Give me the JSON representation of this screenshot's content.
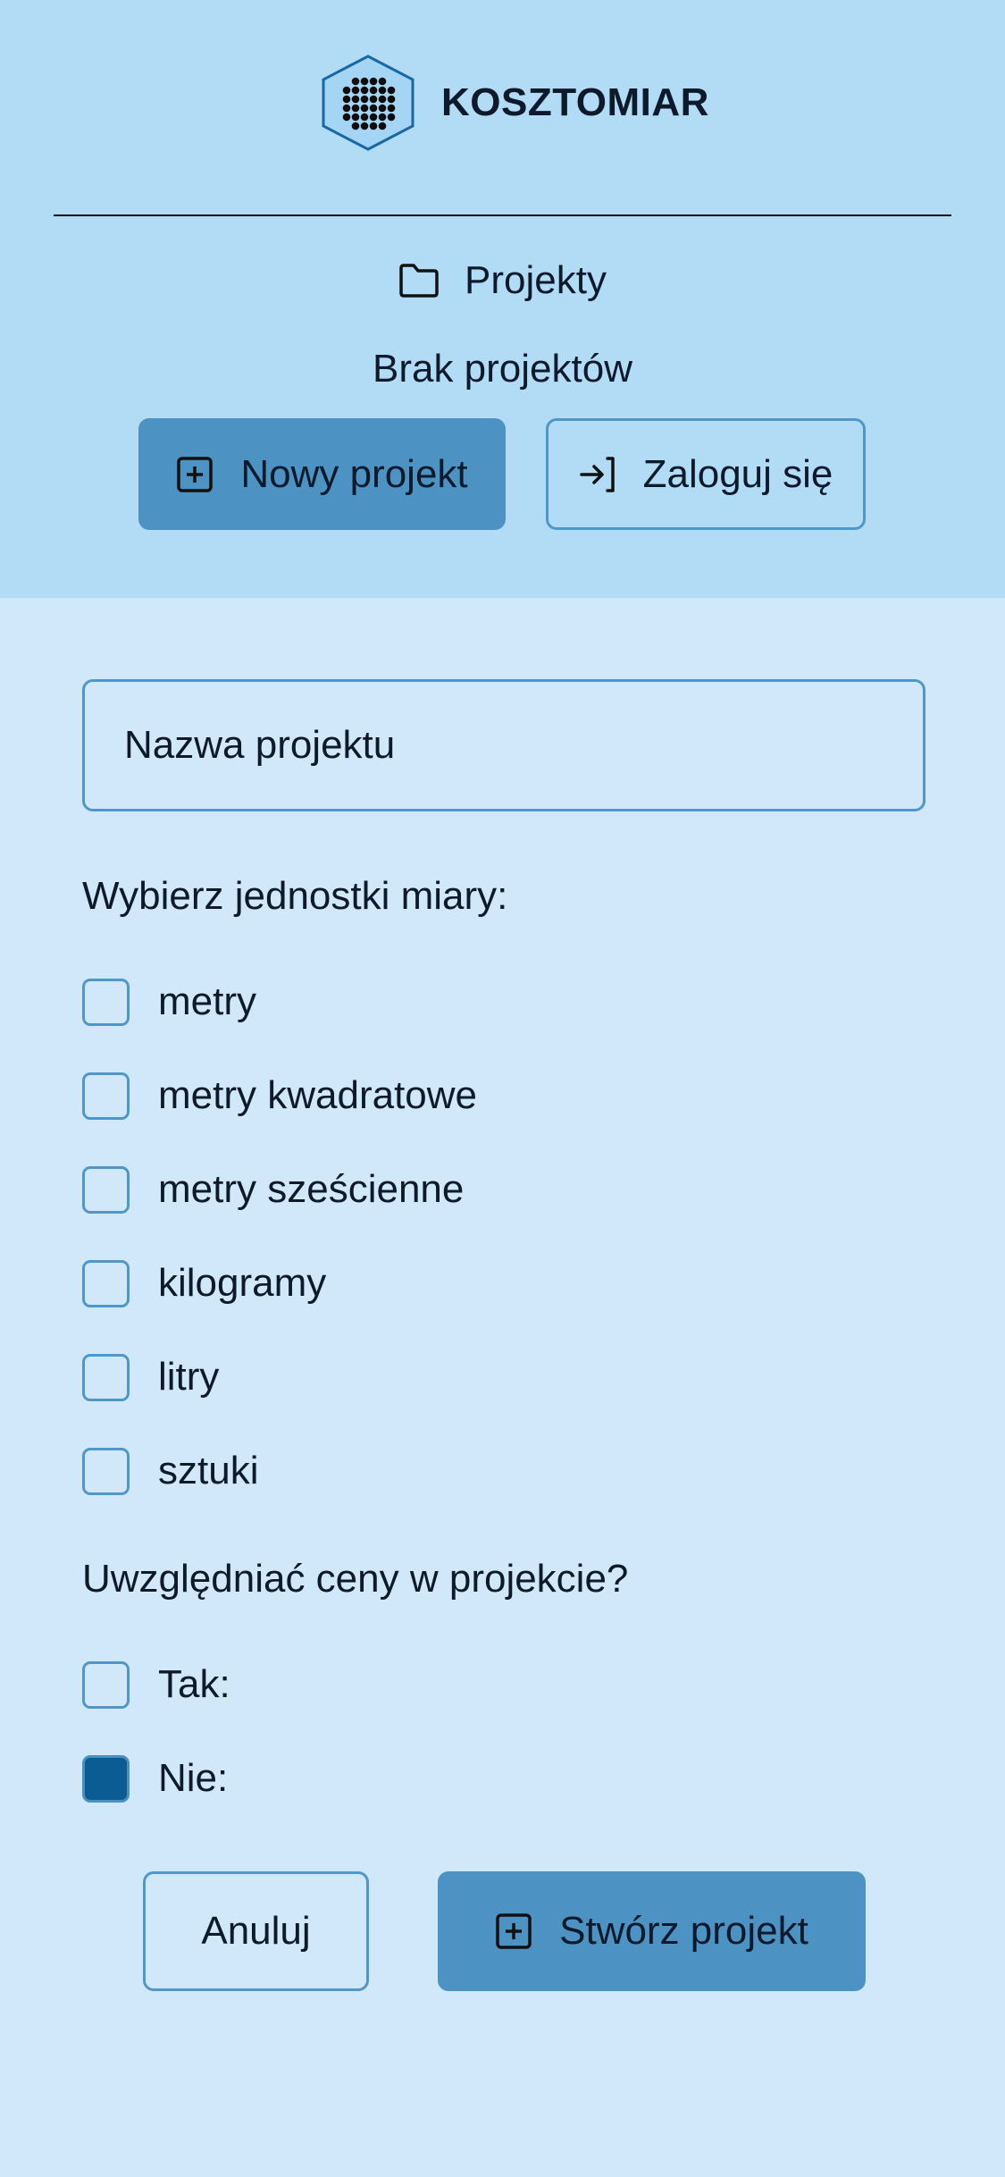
{
  "header": {
    "brand_name": "KOSZTOMIAR",
    "logo_icon": "hexagon-dots-icon",
    "nav_label": "Projekty",
    "nav_icon": "folder-icon",
    "empty_message": "Brak projektów",
    "new_project_label": "Nowy projekt",
    "new_project_icon": "plus-square-icon",
    "login_label": "Zaloguj się",
    "login_icon": "login-arrow-icon"
  },
  "form": {
    "name_placeholder": "Nazwa projektu",
    "name_value": "",
    "units_label": "Wybierz jednostki miary:",
    "units": [
      {
        "label": "metry",
        "checked": false
      },
      {
        "label": "metry kwadratowe",
        "checked": false
      },
      {
        "label": "metry sześcienne",
        "checked": false
      },
      {
        "label": "kilogramy",
        "checked": false
      },
      {
        "label": "litry",
        "checked": false
      },
      {
        "label": "sztuki",
        "checked": false
      }
    ],
    "prices_label": "Uwzględniać ceny w projekcie?",
    "prices_options": [
      {
        "label": "Tak:",
        "checked": false
      },
      {
        "label": "Nie:",
        "checked": true
      }
    ],
    "cancel_label": "Anuluj",
    "create_label": "Stwórz projekt",
    "create_icon": "plus-square-icon"
  },
  "colors": {
    "header_bg": "#b2dcf6",
    "page_bg": "#d1e8fa",
    "primary": "#4c93c3",
    "outline": "#4f97c8",
    "checked": "#0c5c94",
    "text": "#0c1a2b"
  }
}
